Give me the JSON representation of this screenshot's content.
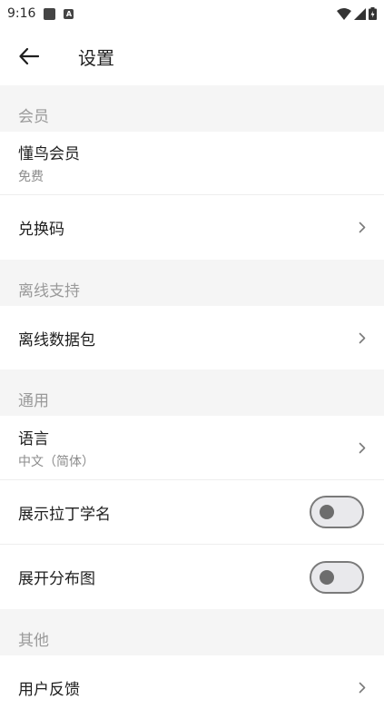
{
  "status_bar": {
    "time": "9:16"
  },
  "app_bar": {
    "title": "设置"
  },
  "sections": {
    "membership": {
      "header": "会员",
      "member_title": "懂鸟会员",
      "member_sub": "免费",
      "redeem": "兑换码"
    },
    "offline": {
      "header": "离线支持",
      "packages": "离线数据包"
    },
    "general": {
      "header": "通用",
      "language_title": "语言",
      "language_value": "中文（简体）",
      "latin_names": "展示拉丁学名",
      "latin_names_enabled": false,
      "distribution_map": "展开分布图",
      "distribution_map_enabled": false
    },
    "other": {
      "header": "其他",
      "feedback": "用户反馈"
    }
  }
}
